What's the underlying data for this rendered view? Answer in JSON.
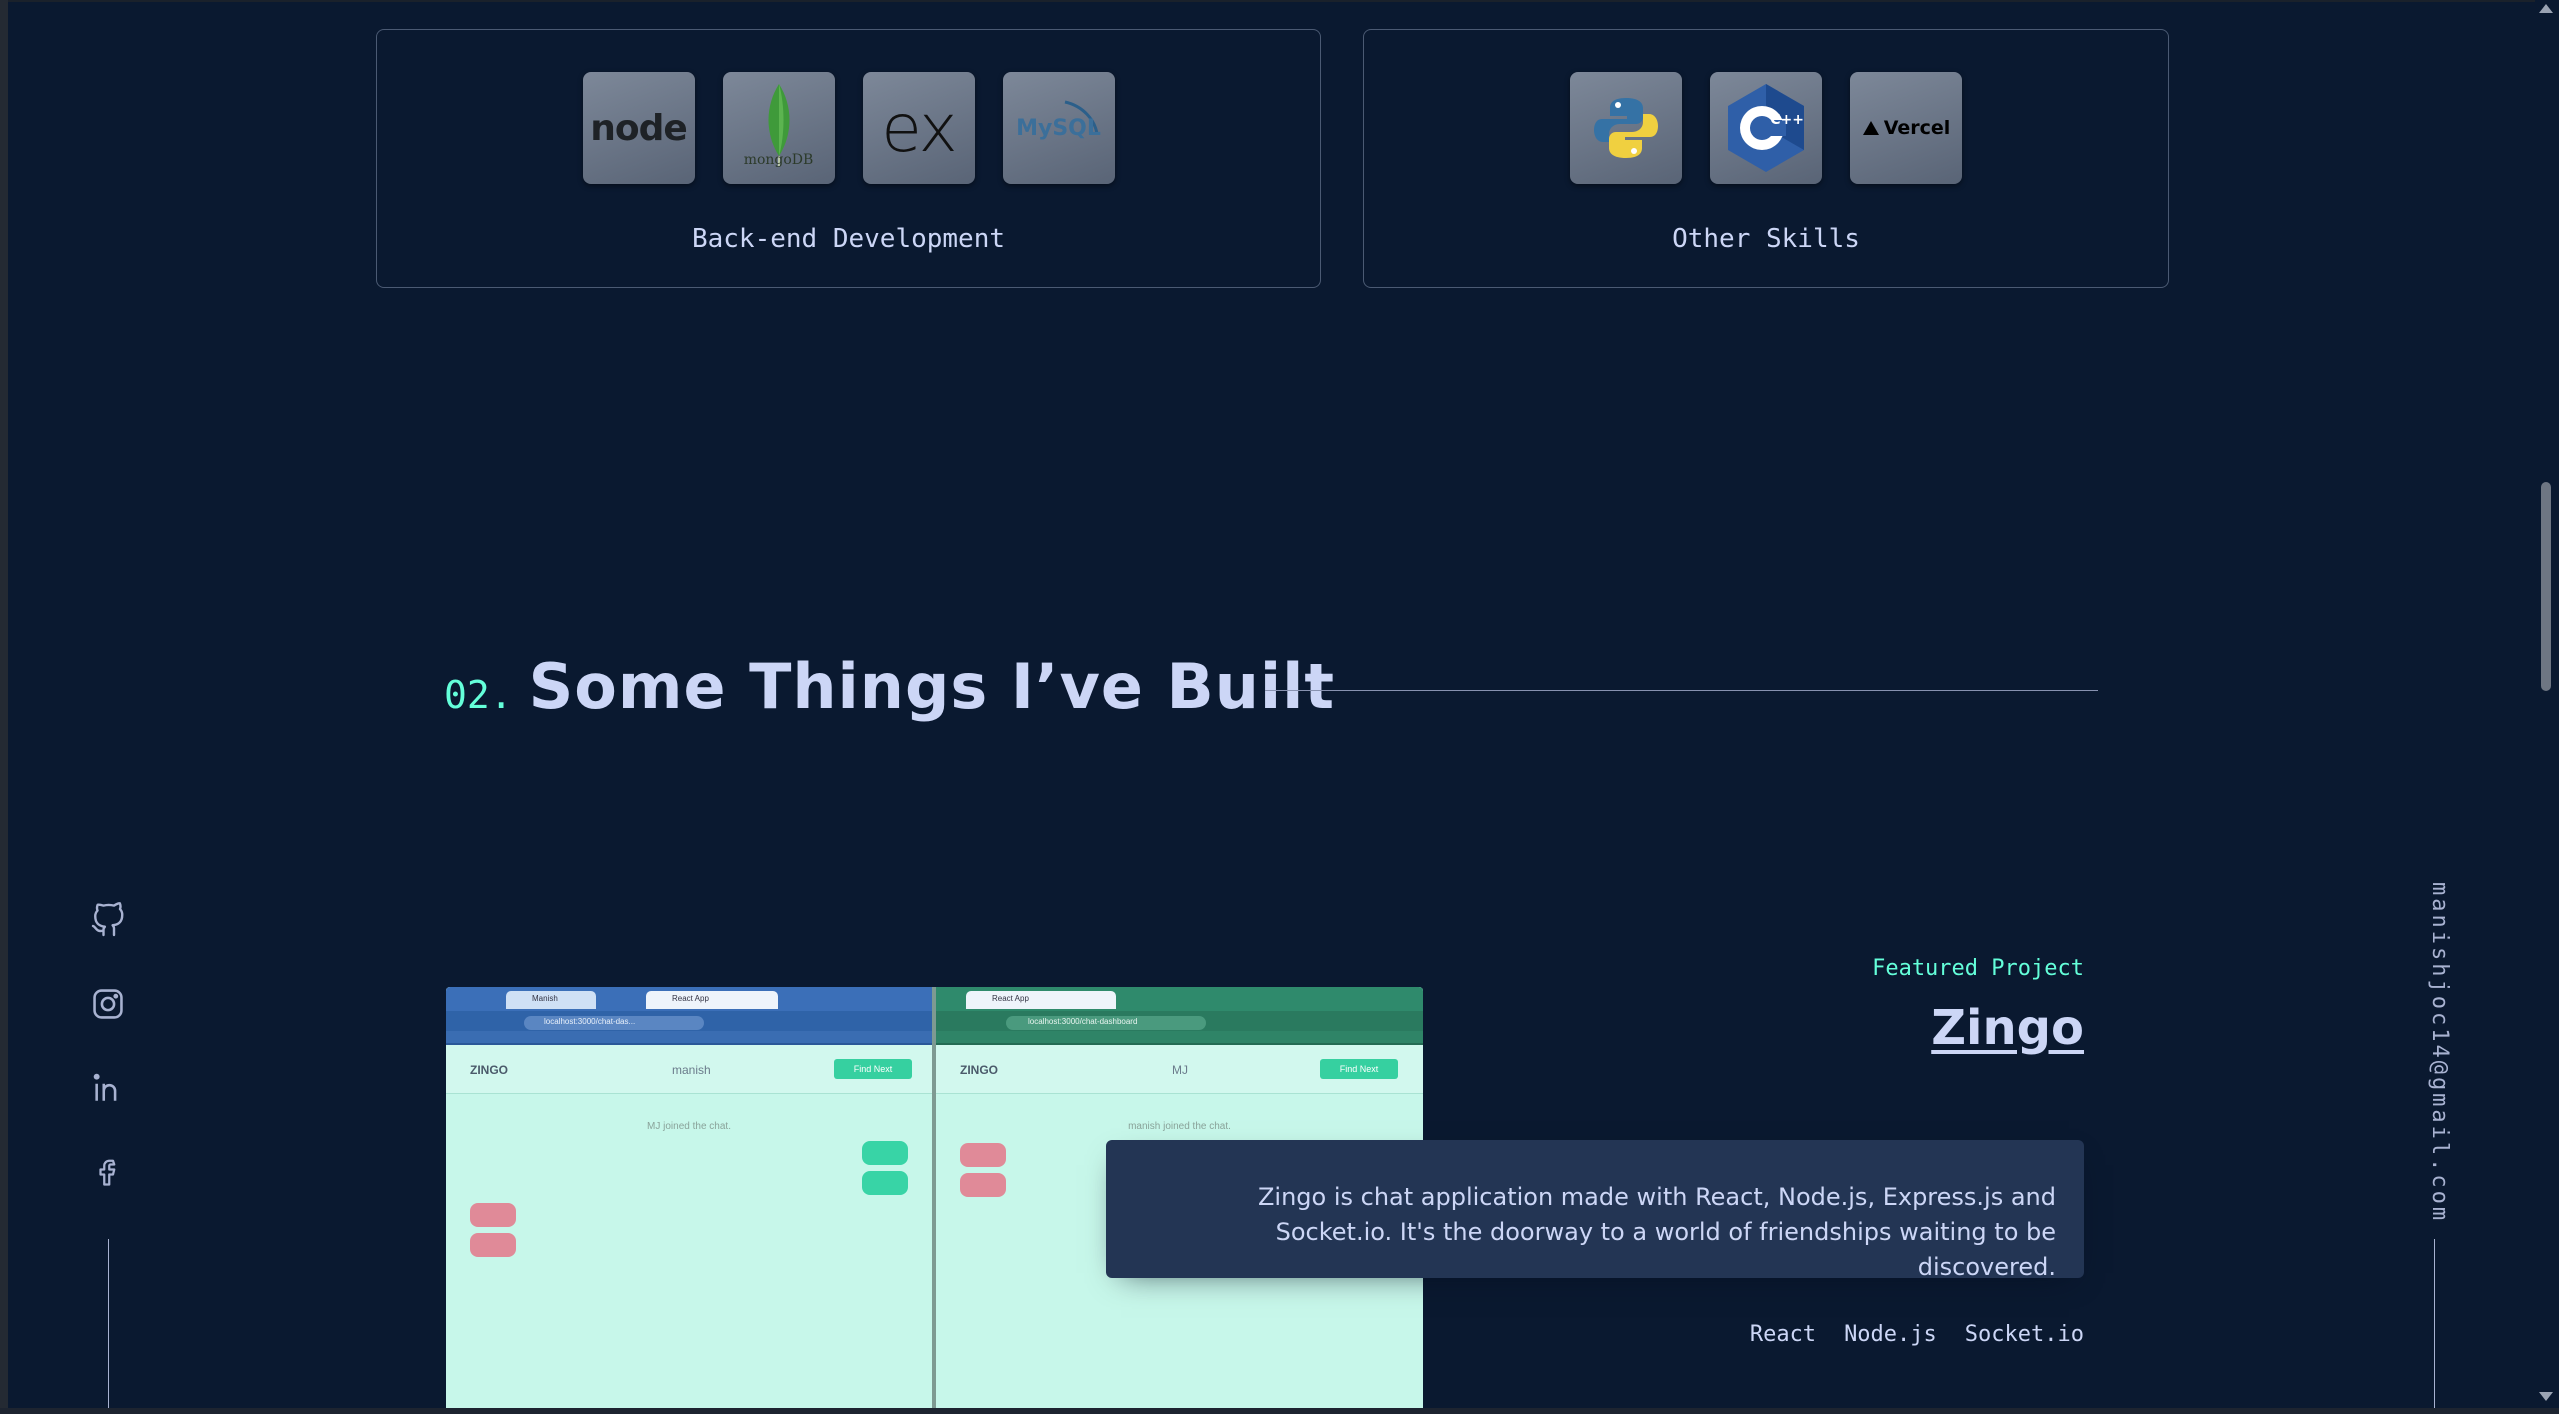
{
  "skills": {
    "back_end": {
      "title": "Back-end Development",
      "icons": [
        "node-icon",
        "mongodb-icon",
        "express-icon",
        "mysql-icon"
      ],
      "node_text": "node",
      "mongo_text": "mongoDB",
      "express_text": "ex",
      "mysql_text": "MySQL"
    },
    "other": {
      "title": "Other Skills",
      "icons": [
        "python-icon",
        "cpp-icon",
        "vercel-icon"
      ],
      "cpp_text": "C++",
      "vercel_text": "Vercel"
    }
  },
  "section": {
    "number": "02.",
    "title": "Some Things I’ve Built"
  },
  "socials": [
    "github-icon",
    "instagram-icon",
    "linkedin-icon",
    "facebook-icon"
  ],
  "email": "manishjoc14@gmail.com",
  "project": {
    "overline": "Featured Project",
    "title": "Zingo",
    "description": "Zingo is chat application made with React, Node.js, Express.js and Socket.io. It's the doorway to a world of friendships waiting to be discovered.",
    "tech": [
      "React",
      "Node.js",
      "Socket.io"
    ],
    "screenshot": {
      "app_name": "ZINGO",
      "left_user": "manish",
      "right_user": "MJ",
      "find_button": "Find Next",
      "left_joined": "MJ joined the chat.",
      "right_joined": "manish joined the chat.",
      "left_tabs": [
        "Manish",
        "React App"
      ],
      "right_tab": "React App",
      "url": "localhost:3000/chat-das...",
      "right_url": "localhost:3000/chat-dashboard"
    }
  },
  "colors": {
    "background": "#0a1930",
    "accent": "#64ffda",
    "text": "#ccd6f6",
    "panel": "#233554"
  }
}
